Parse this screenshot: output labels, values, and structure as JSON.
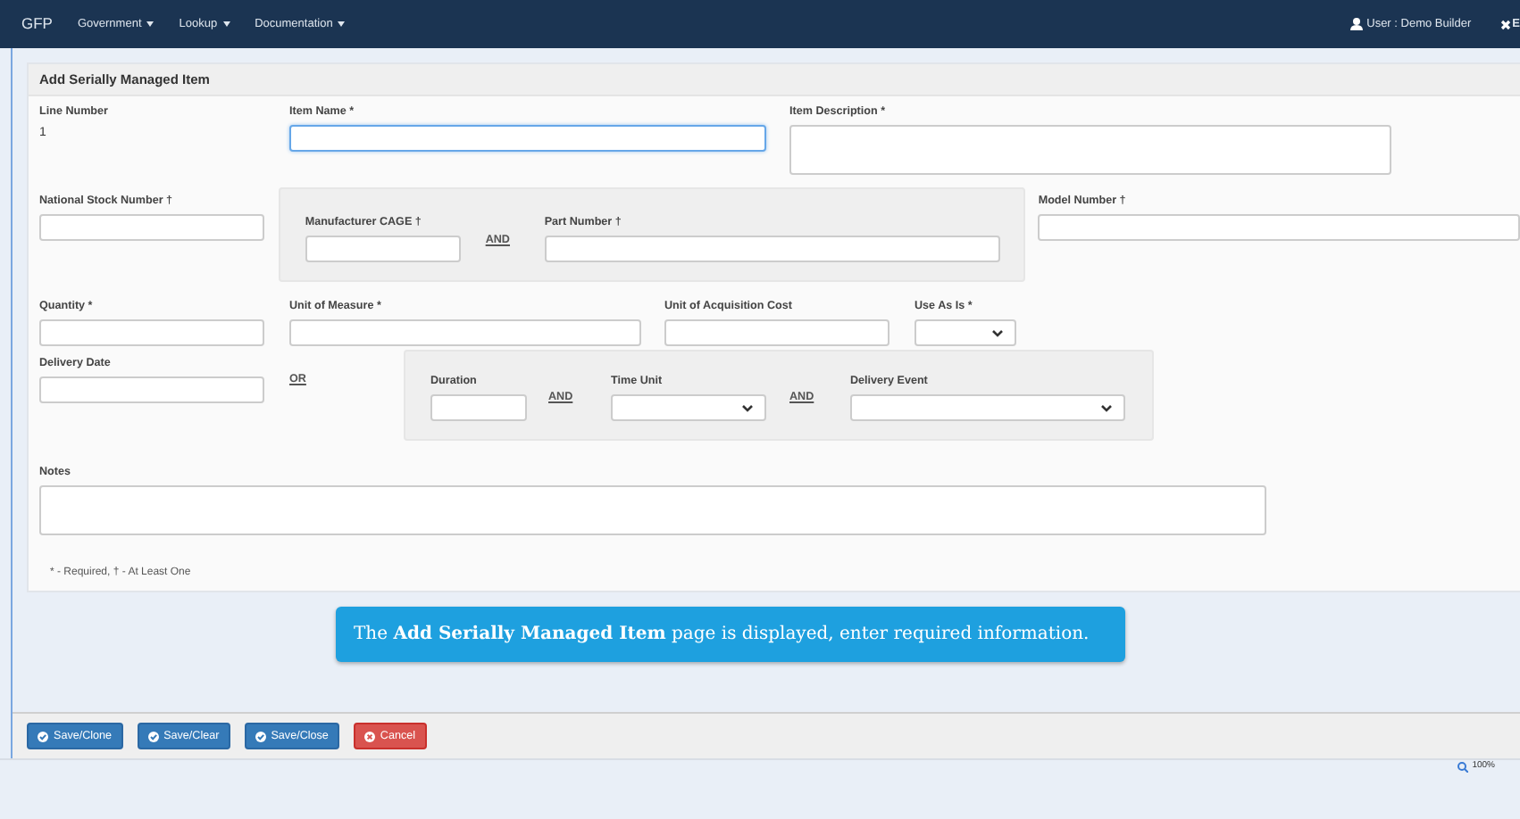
{
  "navbar": {
    "brand": "GFP",
    "menus": [
      "Government",
      "Lookup",
      "Documentation"
    ],
    "user": "User : Demo Builder",
    "exit": "E"
  },
  "form": {
    "title": "Add Serially Managed Item",
    "rows": [
      {
        "items": [
          {
            "kind": "static",
            "label": "Line Number",
            "value": "1"
          },
          {
            "kind": "text",
            "label": "Item Name *",
            "focused": true
          },
          {
            "kind": "textarea",
            "label": "Item Description *",
            "focused": false
          }
        ]
      },
      {
        "items": [
          {
            "kind": "text",
            "label": "National Stock Number †",
            "focused": false
          },
          {
            "kind": "group",
            "items": [
              {
                "kind": "text",
                "label": "Manufacturer CAGE †",
                "focused": false
              },
              {
                "kind": "connector",
                "text": "AND"
              },
              {
                "kind": "text",
                "label": "Part Number †",
                "focused": false
              }
            ]
          },
          {
            "kind": "text",
            "label": "Model Number †",
            "focused": false
          }
        ]
      },
      {
        "items": [
          {
            "kind": "text",
            "label": "Quantity *",
            "focused": false
          },
          {
            "kind": "text",
            "label": "Unit of Measure *",
            "focused": false
          },
          {
            "kind": "text",
            "label": "Unit of Acquisition Cost",
            "focused": false
          },
          {
            "kind": "select",
            "label": "Use As Is *",
            "focused": false
          }
        ]
      },
      {
        "items": [
          {
            "kind": "text",
            "label": "Delivery Date",
            "focused": false
          },
          {
            "kind": "connector",
            "text": "OR"
          },
          {
            "kind": "group",
            "items": [
              {
                "kind": "text",
                "label": "Duration",
                "focused": false
              },
              {
                "kind": "connector",
                "text": "AND"
              },
              {
                "kind": "select",
                "label": "Time Unit",
                "focused": false
              },
              {
                "kind": "connector",
                "text": "AND"
              },
              {
                "kind": "select",
                "label": "Delivery Event",
                "focused": false
              }
            ]
          }
        ]
      },
      {
        "items": [
          {
            "kind": "textarea",
            "label": "Notes",
            "focused": false
          }
        ]
      }
    ],
    "footnote": "* - Required, † - At Least One"
  },
  "callout": "The **Add Serially Managed Item** page is displayed, enter required information.",
  "buttons": [
    {
      "label": "Save/Clone",
      "kind": "save"
    },
    {
      "label": "Save/Clear",
      "kind": "save"
    },
    {
      "label": "Save/Close",
      "kind": "save"
    },
    {
      "label": "Cancel",
      "kind": "cancel"
    }
  ],
  "status_bar": {
    "zoom": "100%"
  }
}
